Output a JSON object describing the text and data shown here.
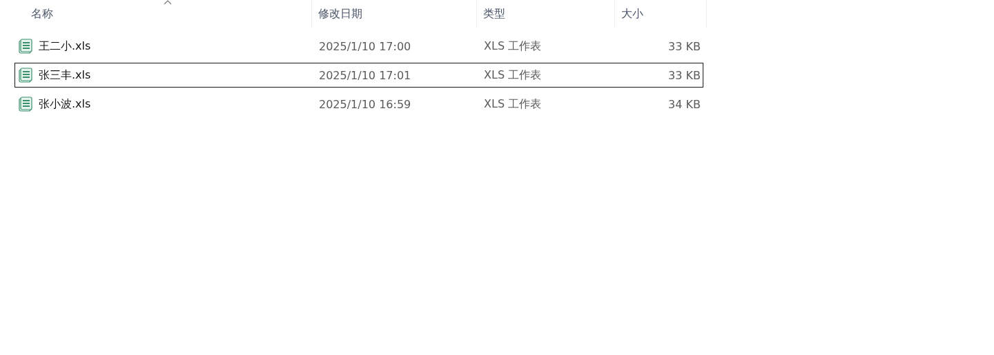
{
  "columns": [
    {
      "label": "名称",
      "sorted": true
    },
    {
      "label": "修改日期",
      "sorted": false
    },
    {
      "label": "类型",
      "sorted": false
    },
    {
      "label": "大小",
      "sorted": false
    }
  ],
  "rows": [
    {
      "name": "王二小.xls",
      "modified": "2025/1/10 17:00",
      "type": "XLS 工作表",
      "size": "33 KB",
      "selected": false
    },
    {
      "name": "张三丰.xls",
      "modified": "2025/1/10 17:01",
      "type": "XLS 工作表",
      "size": "33 KB",
      "selected": true
    },
    {
      "name": "张小波.xls",
      "modified": "2025/1/10 16:59",
      "type": "XLS 工作表",
      "size": "34 KB",
      "selected": false
    }
  ]
}
